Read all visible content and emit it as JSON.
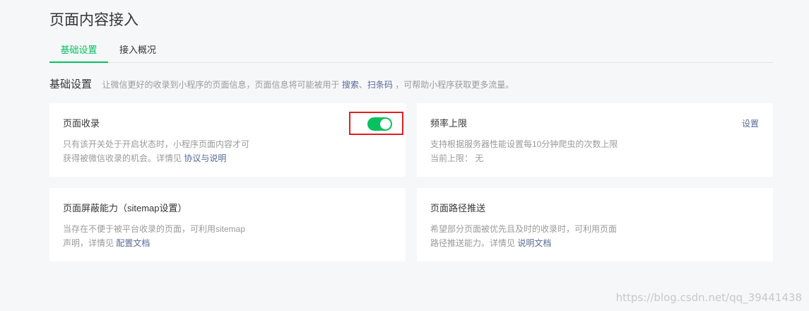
{
  "page": {
    "title": "页面内容接入"
  },
  "tabs": [
    {
      "label": "基础设置",
      "active": true
    },
    {
      "label": "接入概况",
      "active": false
    }
  ],
  "section": {
    "title": "基础设置",
    "desc_prefix": "让微信更好的收录到小程序的页面信息，页面信息将可能被用于",
    "link_search": "搜索",
    "sep": "、",
    "link_scan": "扫条码",
    "desc_suffix": "，可帮助小程序获取更多流量。"
  },
  "cards": {
    "page_index": {
      "title": "页面收录",
      "desc_line1": "只有该开关处于开启状态时，小程序页面内容才可",
      "desc_line2": "获得被微信收录的机会。详情见",
      "link": "协议与说明",
      "toggle_on": true
    },
    "rate_limit": {
      "title": "频率上限",
      "action": "设置",
      "desc_line1": "支持根据服务器性能设置每10分钟爬虫的次数上限",
      "desc_line2": "当前上限： 无"
    },
    "sitemap": {
      "title": "页面屏蔽能力（sitemap设置）",
      "desc_line1": "当存在不便于被平台收录的页面，可利用sitemap",
      "desc_line2": "声明，详情见",
      "link": "配置文档"
    },
    "path_push": {
      "title": "页面路径推送",
      "desc_line1": "希望部分页面被优先且及时的收录时，可利用页面",
      "desc_line2": "路径推送能力。详情见",
      "link": "说明文档"
    }
  },
  "colors": {
    "accent": "#07c160",
    "link": "#576b95",
    "highlight": "#e02020"
  },
  "watermark": "https://blog.csdn.net/qq_39441438"
}
